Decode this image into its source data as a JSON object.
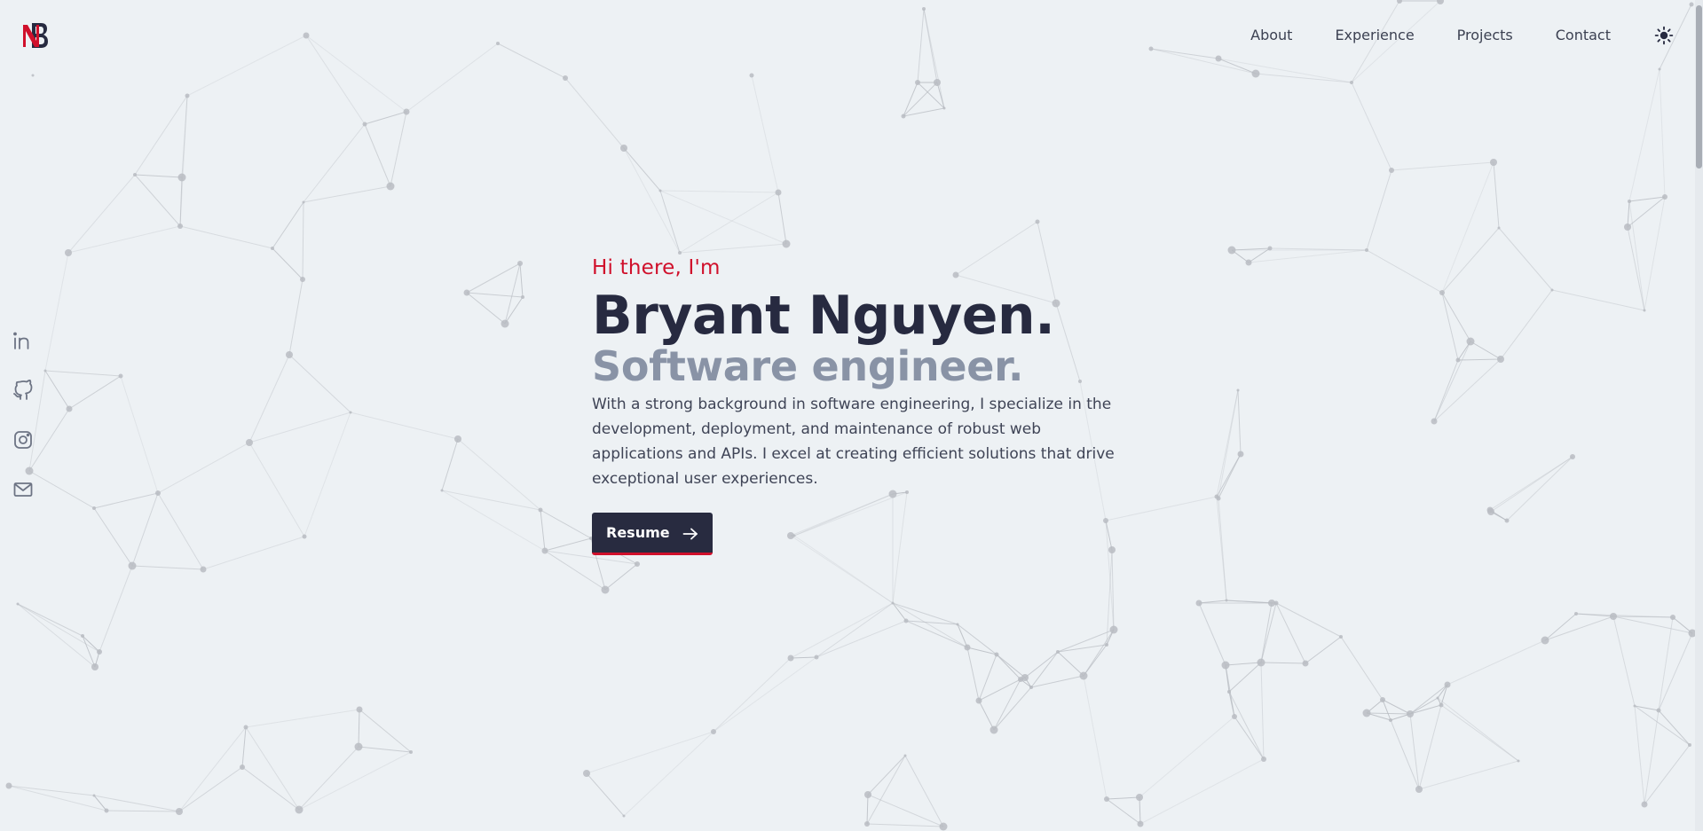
{
  "logo": {
    "text": "NB",
    "icon": "brand-logo-icon",
    "colors": {
      "red": "#d0102b",
      "navy": "#272a40"
    }
  },
  "nav": {
    "items": [
      {
        "label": "About"
      },
      {
        "label": "Experience"
      },
      {
        "label": "Projects"
      },
      {
        "label": "Contact"
      }
    ],
    "theme_toggle_icon": "sun-icon"
  },
  "social": [
    {
      "icon": "linkedin-icon"
    },
    {
      "icon": "github-icon"
    },
    {
      "icon": "instagram-icon"
    },
    {
      "icon": "email-icon"
    }
  ],
  "hero": {
    "greeting": "Hi there, I'm",
    "name": "Bryant Nguyen.",
    "role": "Software engineer.",
    "description": "With a strong background in software engineering, I specialize in the development, deployment, and maintenance of robust web applications and APIs. I excel at creating efficient solutions that drive exceptional user experiences.",
    "resume_label": "Resume",
    "resume_icon": "arrow-right-icon"
  },
  "colors": {
    "background": "#edf1f4",
    "accent": "#d0102b",
    "navy": "#272a40",
    "muted": "#8993a6",
    "network": "#b8bcc2"
  }
}
